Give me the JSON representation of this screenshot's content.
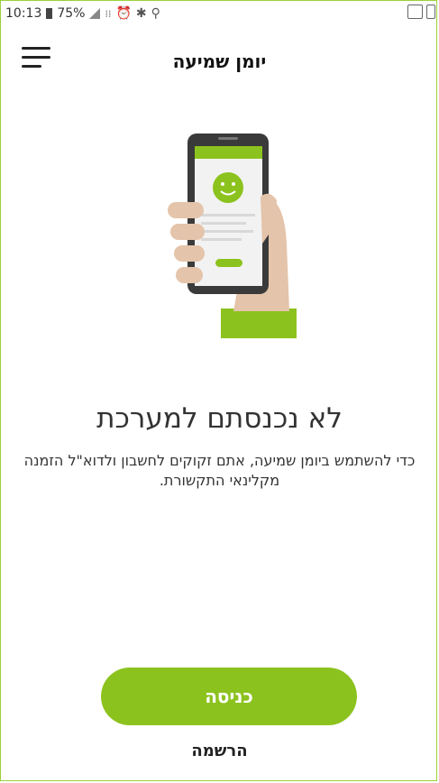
{
  "status_bar": {
    "time": "10:13",
    "battery": "75%",
    "icons": [
      "battery-icon",
      "signal-icon",
      "grid-icon",
      "alarm-icon",
      "bluetooth-icon",
      "location-icon"
    ],
    "right_icons": [
      "message-icon",
      "notification-icon"
    ]
  },
  "header": {
    "title": "יומן שמיעה",
    "menu_icon": "hamburger-menu-icon"
  },
  "main": {
    "heading": "לא נכנסתם למערכת",
    "description": "כדי להשתמש ביומן שמיעה, אתם זקוקים לחשבון ולדוא\"ל הזמנה מקלינאי התקשורת."
  },
  "actions": {
    "login_label": "כניסה",
    "register_label": "הרשמה"
  },
  "colors": {
    "accent": "#8cc21e",
    "frame": "#9bd13a",
    "text": "#333333"
  }
}
